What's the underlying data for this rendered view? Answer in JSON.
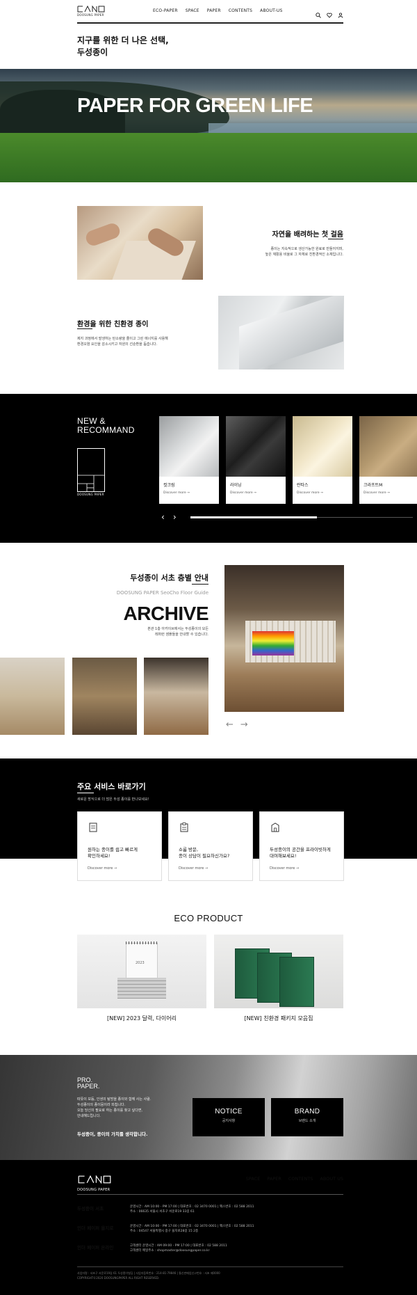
{
  "header": {
    "logo_text": "DOOSUNG PAPER",
    "nav": [
      "ECO-PAPER",
      "SPACE",
      "PAPER",
      "CONTENTS",
      "ABOUT-US"
    ],
    "icons": [
      "search-icon",
      "heart-icon",
      "user-icon"
    ]
  },
  "intro": {
    "title": "지구를 위한 더 나은 선택,\n두성종이"
  },
  "hero": {
    "text": "PAPER FOR GREEN LIFE"
  },
  "features": [
    {
      "title": "자연을 배려하는 첫 걸음",
      "desc": "종이는 지속적으로 생산가능한 원료로 만들어지며,\n높은 재활용 비율로 그 자체로 친환경적인 소재입니다."
    },
    {
      "title": "환경을 위한 친환경 종이",
      "desc": "제지 과정에서 발생하는 탄소량을 줄이고 그린 에너지를 사용해\n환경오염 요인을 감소시키고 자원의 선순환을 돕습니다."
    }
  ],
  "new_recommand": {
    "title": "NEW &\nRECOMMAND",
    "logo_text": "DOOSUNG PAPER",
    "cards": [
      {
        "name": "컷크림",
        "more": "Discover more →"
      },
      {
        "name": "라이닝",
        "more": "Discover more →"
      },
      {
        "name": "란타스",
        "more": "Discover more →"
      },
      {
        "name": "크라프트M",
        "more": "Discover more →"
      }
    ],
    "prev": "‹",
    "next": "›",
    "progress": 0.57
  },
  "archive": {
    "title": "두성종이 서초 층별 안내",
    "subtitle": "DOOSUNG PAPER SeoCho Floor Guide",
    "big": "ARCHIVE",
    "desc": "본관 1층 아카이브에서는 두성종이의 모든\n레퍼런 샘플들을 안내할 수 있습니다.",
    "prev": "←",
    "next": "→"
  },
  "services": {
    "title": "주요 서비스 바로가기",
    "subtitle": "새로운 방식으로 더 많은 두성 종이를 만나보세요!",
    "cards": [
      {
        "text": "원하는 종이를 쉽고 빠르게\n확인하세요!",
        "more": "Discover more →"
      },
      {
        "text": "쇼룸 방문,\n종이 상담이 필요하신가요?",
        "more": "Discover more →"
      },
      {
        "text": "두성종이의 공간을 프라이빗하게\n대여해보세요!",
        "more": "Discover more →"
      }
    ]
  },
  "eco_product": {
    "title": "ECO PRODUCT",
    "items": [
      {
        "name": "[NEW] 2023 달력, 다이어리",
        "label": "2023"
      },
      {
        "name": "[NEW] 친환경 패키지 모음집"
      }
    ]
  },
  "pro_paper": {
    "title": "PRO.\nPAPER.",
    "desc": "따뜻이 보듬, 인생의 탐방을 종이와 함께 사는 사람.\n두성종이의 종이뭉이라 외칩니다.\n오늘 당신의 필요로 하는 종이를 찾고 싶다면,\n안내해드립니다.",
    "bold": "두성종이, 종이의 가치를 생각합니다.",
    "buttons": [
      {
        "title": "NOTICE",
        "sub": "공지사항"
      },
      {
        "title": "BRAND",
        "sub": "브랜드 소개"
      }
    ]
  },
  "footer": {
    "logo_text": "DOOSUNG PAPER",
    "nav": [
      "SPACE",
      "PAPER",
      "CONTENTS",
      "ABOUT US"
    ],
    "rows": [
      {
        "name": "두성종이 서초",
        "info": "운영시간 : AM 10:00 - PM 17:00  |  대표번호 : 02 3470 0001  |  팩스번호 : 02 588 2011\n주소 : 06635 서울시 서초구 서운로19 33길 61"
      },
      {
        "name": "인더 페이퍼 을지로",
        "info": "운영시간 : AM 10:00 - PM 17:00  |  대표번호 : 02 3470 0001  |  팩스번호 : 02 588 2011\n주소 : 04547 서울특별시 중구 을지로28길 15 2층"
      },
      {
        "name": "인더 페이퍼 온라인",
        "info": "고객센터 운영시간 : AM 09:00 - PM 17:00  |  대표번호 : 02 588 2011\n고객센터 메일주소 : shopmaster@doosungpaper.co.kr"
      }
    ],
    "copy": "사업자명 : 서초구 서운로19길 61 두성종이빌딩  |  사업자등록번호 : 214-81-79846  |  통신판매업신고번호 : 서초 제0000\nCOPYRIGHT©2020 DOOSUNGPAPER ALL RIGHT RESERVED."
  }
}
